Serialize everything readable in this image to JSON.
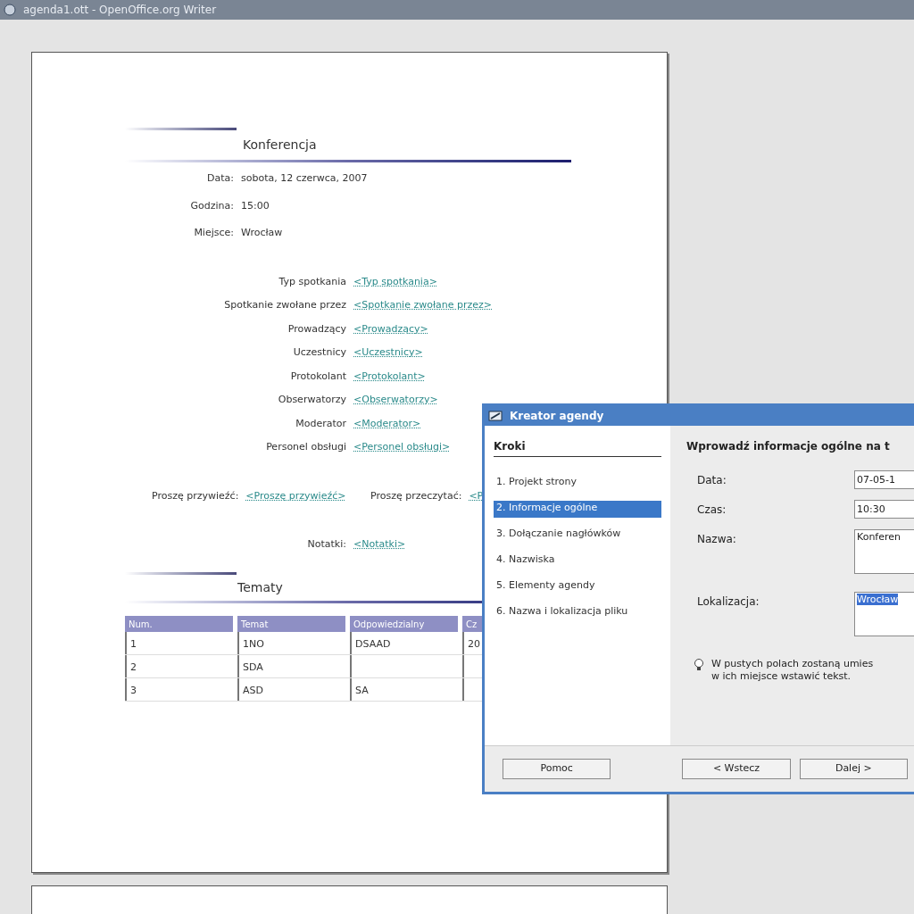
{
  "window": {
    "title": "agenda1.ott - OpenOffice.org Writer"
  },
  "document": {
    "title": "Konferencja",
    "info": [
      {
        "label": "Data:",
        "value": "sobota, 12 czerwca, 2007"
      },
      {
        "label": "Godzina:",
        "value": "15:00"
      },
      {
        "label": "Miejsce:",
        "value": "Wrocław"
      }
    ],
    "roles": [
      {
        "label": "Typ spotkania",
        "value": "<Typ spotkania>"
      },
      {
        "label": "Spotkanie zwołane przez",
        "value": "<Spotkanie zwołane przez>"
      },
      {
        "label": "Prowadzący",
        "value": "<Prowadzący>"
      },
      {
        "label": "Uczestnicy",
        "value": "<Uczestnicy>"
      },
      {
        "label": "Protokolant",
        "value": "<Protokolant>"
      },
      {
        "label": "Obserwatorzy",
        "value": "<Obserwatorzy>"
      },
      {
        "label": "Moderator",
        "value": "<Moderator>"
      },
      {
        "label": "Personel obsługi",
        "value": "<Personel obsługi>"
      }
    ],
    "bring": {
      "label": "Proszę przywieźć:",
      "value": "<Proszę przywieźć>"
    },
    "read": {
      "label": "Proszę przeczytać:",
      "value": "<P"
    },
    "notes": {
      "label": "Notatki:",
      "value": "<Notatki>"
    },
    "topics": {
      "title": "Tematy",
      "columns": [
        "Num.",
        "Temat",
        "Odpowiedzialny",
        "Cz"
      ],
      "rows": [
        [
          "1",
          "1NO",
          "DSAAD",
          "20"
        ],
        [
          "2",
          "SDA",
          "",
          ""
        ],
        [
          "3",
          "ASD",
          "SA",
          ""
        ]
      ]
    }
  },
  "dialog": {
    "title": "Kreator agendy",
    "steps_heading": "Kroki",
    "steps": [
      {
        "label": "1. Projekt strony",
        "selected": false
      },
      {
        "label": "2. Informacje ogólne",
        "selected": true
      },
      {
        "label": "3. Dołączanie nagłówków",
        "selected": false
      },
      {
        "label": "4. Nazwiska",
        "selected": false
      },
      {
        "label": "5. Elementy agendy",
        "selected": false
      },
      {
        "label": "6. Nazwa i lokalizacja pliku",
        "selected": false
      }
    ],
    "heading": "Wprowadź informacje ogólne na t",
    "fields": [
      {
        "kind": "text",
        "label": "Data:",
        "value": "07-05-1",
        "highlighted": false
      },
      {
        "kind": "text",
        "label": "Czas:",
        "value": "10:30",
        "highlighted": false
      },
      {
        "kind": "area",
        "label": "Nazwa:",
        "value": "Konferen",
        "highlighted": false
      },
      {
        "kind": "area",
        "label": "Lokalizacja:",
        "value": "Wrocław",
        "highlighted": true
      }
    ],
    "hint": [
      "W pustych polach zostaną umies",
      "w ich miejsce wstawić tekst."
    ],
    "buttons": [
      "Pomoc",
      "< Wstecz",
      "Dalej >"
    ]
  }
}
